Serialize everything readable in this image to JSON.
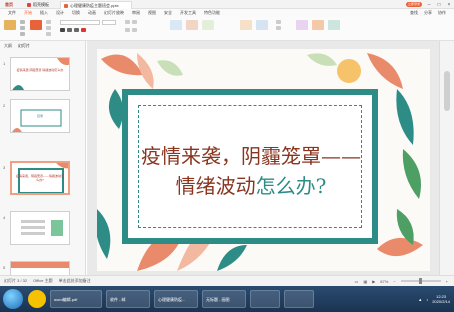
{
  "tabs": {
    "home": "首页",
    "templates": "稻壳模板",
    "document": "心理健康防疫主题班会.pptx"
  },
  "window": {
    "login_label": "立即登录"
  },
  "menu": {
    "file": "文件",
    "items": [
      "开始",
      "插入",
      "设计",
      "切换",
      "动画",
      "幻灯片放映",
      "审阅",
      "视图",
      "安全",
      "开发工具",
      "特色功能"
    ],
    "active_index": 0,
    "right": [
      "查找",
      "分享",
      "协作"
    ]
  },
  "left_panel": {
    "tabs": [
      "大纲",
      "幻灯片"
    ],
    "slides": [
      {
        "num": "1",
        "text": "疫情来袭 阴霾笼罩 情绪波动怎么办"
      },
      {
        "num": "2",
        "text": "目录"
      },
      {
        "num": "3",
        "text": "疫情来袭，阴霾笼罩——情绪波动怎么办?"
      },
      {
        "num": "4",
        "text": ""
      },
      {
        "num": "5",
        "text": ""
      }
    ]
  },
  "slide": {
    "title_line1": "疫情来袭，阴霾笼罩——",
    "title_line2_main": "情绪波动",
    "title_line2_accent": "怎么办?"
  },
  "status": {
    "slide_counter": "幻灯片 3 / 32",
    "theme": "Office 主题",
    "notes": "单击此处添加备注",
    "zoom": "87%"
  },
  "taskbar": {
    "items": [
      "word编辑.pdf",
      "收件 - 邮",
      "心理健康防疫...",
      "无标题 - 画图",
      "",
      ""
    ],
    "time": "12:23",
    "date": "2020/2/14"
  },
  "colors": {
    "accent": "#e8623a",
    "teal": "#2e8c86",
    "title_red": "#8a3520"
  }
}
